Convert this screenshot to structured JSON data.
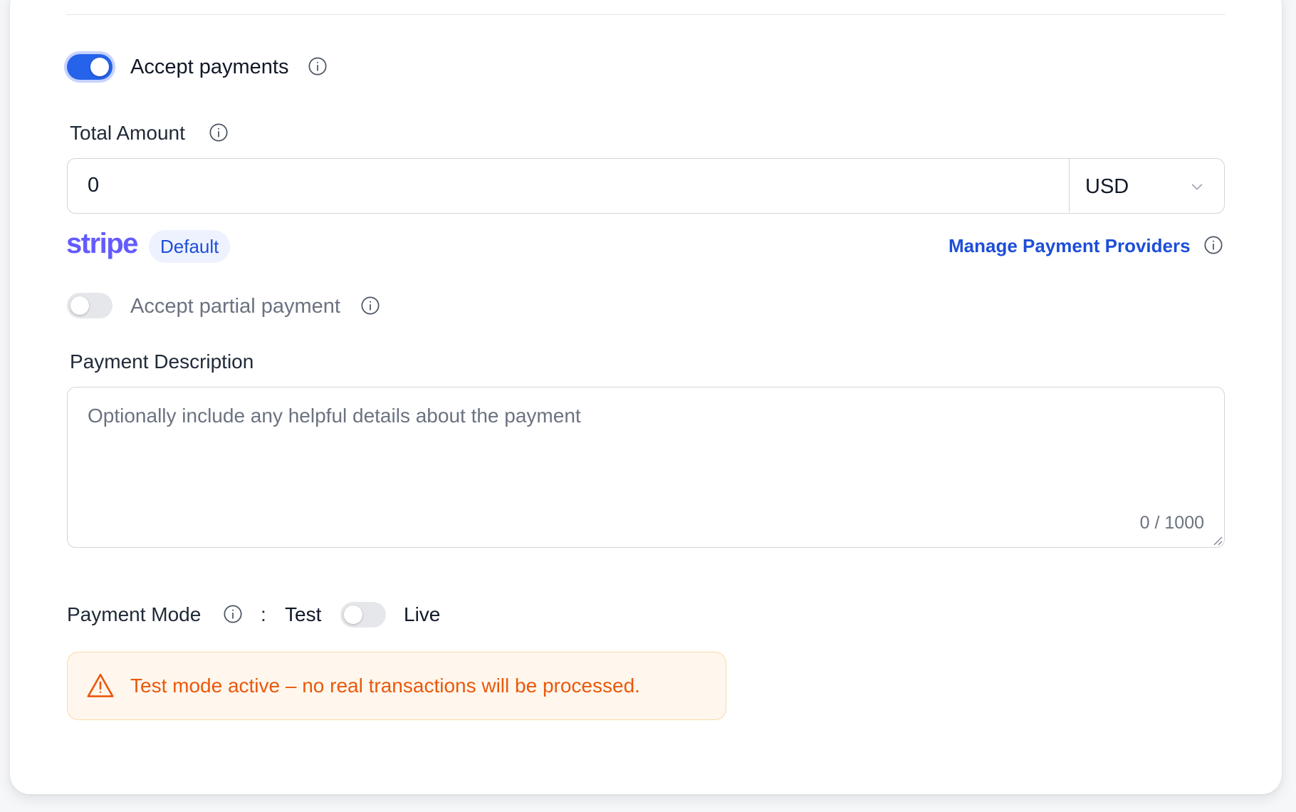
{
  "accept_payments": {
    "label": "Accept payments",
    "enabled": true
  },
  "total_amount": {
    "label": "Total Amount",
    "value": "0",
    "currency": "USD"
  },
  "provider": {
    "name": "stripe",
    "badge": "Default",
    "manage_link": "Manage Payment Providers"
  },
  "partial_payment": {
    "label": "Accept partial payment",
    "enabled": false
  },
  "description": {
    "label": "Payment Description",
    "placeholder": "Optionally include any helpful details about the payment",
    "value": "",
    "char_count": "0 / 1000"
  },
  "payment_mode": {
    "label": "Payment Mode",
    "separator": ":",
    "left_option": "Test",
    "right_option": "Live",
    "is_live": false
  },
  "alert": {
    "text": "Test mode active – no real transactions will be processed."
  },
  "colors": {
    "primary": "#2563eb",
    "link": "#1d4ed8",
    "stripe": "#635bff",
    "warning_text": "#ea580c",
    "warning_bg": "#fff7ed"
  }
}
